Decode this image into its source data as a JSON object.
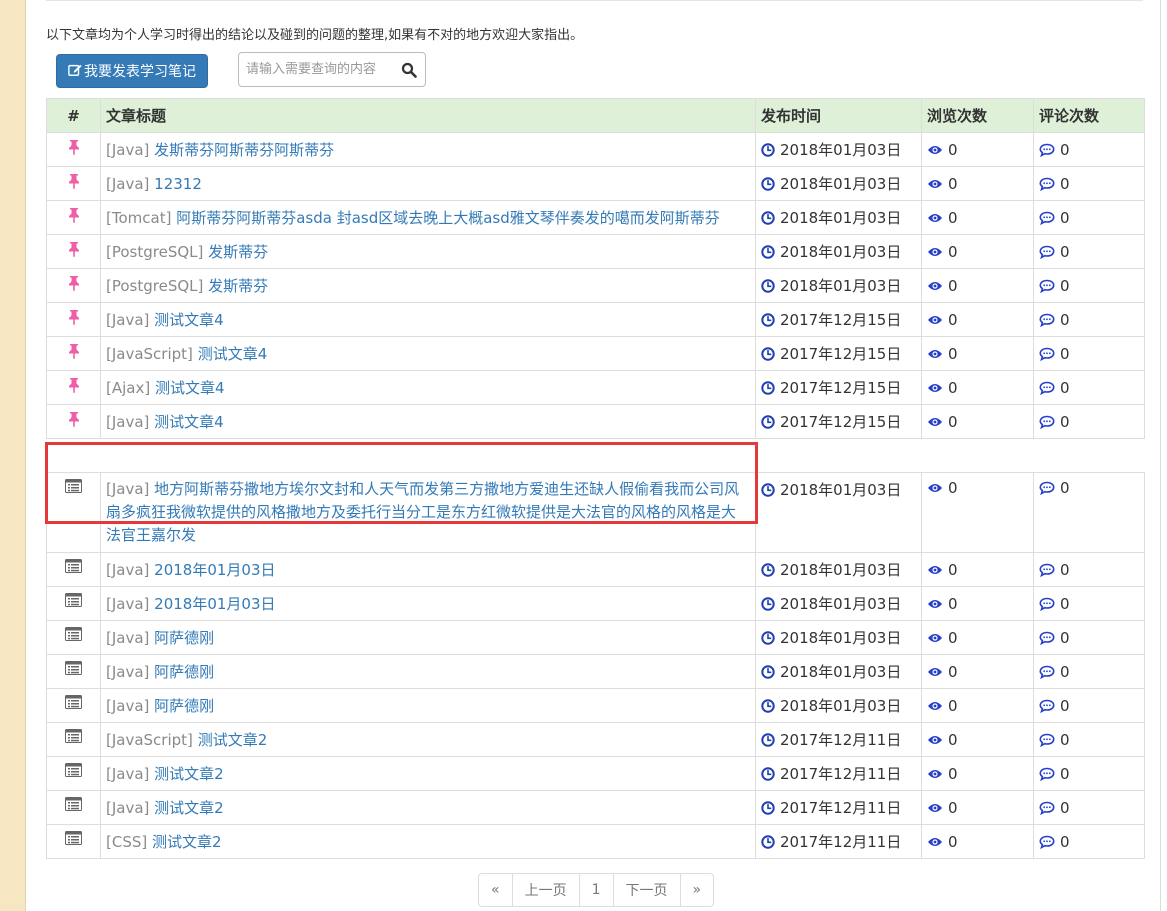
{
  "notice": "以下文章均为个人学习时得出的结论以及碰到的问题的整理,如果有不对的地方欢迎大家指出。",
  "toolbar": {
    "post_label": "我要发表学习笔记"
  },
  "search": {
    "placeholder": "请输入需要查询的内容"
  },
  "table": {
    "headers": [
      "#",
      "文章标题",
      "发布时间",
      "浏览次数",
      "评论次数"
    ],
    "pinned_rows": [
      {
        "category": "[Java]",
        "title": "发斯蒂芬阿斯蒂芬阿斯蒂芬",
        "date": "2018年01月03日",
        "views": "0",
        "comments": "0"
      },
      {
        "category": "[Java]",
        "title": "12312",
        "date": "2018年01月03日",
        "views": "0",
        "comments": "0"
      },
      {
        "category": "[Tomcat]",
        "title": "阿斯蒂芬阿斯蒂芬asda 封asd区域去晚上大概asd雅文琴伴奏发的噶而发阿斯蒂芬",
        "date": "2018年01月03日",
        "views": "0",
        "comments": "0"
      },
      {
        "category": "[PostgreSQL]",
        "title": "发斯蒂芬",
        "date": "2018年01月03日",
        "views": "0",
        "comments": "0"
      },
      {
        "category": "[PostgreSQL]",
        "title": "发斯蒂芬",
        "date": "2018年01月03日",
        "views": "0",
        "comments": "0"
      },
      {
        "category": "[Java]",
        "title": "测试文章4",
        "date": "2017年12月15日",
        "views": "0",
        "comments": "0"
      },
      {
        "category": "[JavaScript]",
        "title": "测试文章4",
        "date": "2017年12月15日",
        "views": "0",
        "comments": "0"
      },
      {
        "category": "[Ajax]",
        "title": "测试文章4",
        "date": "2017年12月15日",
        "views": "0",
        "comments": "0"
      },
      {
        "category": "[Java]",
        "title": "测试文章4",
        "date": "2017年12月15日",
        "views": "0",
        "comments": "0"
      }
    ],
    "normal_rows": [
      {
        "category": "[Java]",
        "title": "地方阿斯蒂芬撒地方埃尔文封和人天气而发第三方撒地方爱迪生还缺人假偷看我而公司风扇多疯狂我微软提供的风格撒地方及委托行当分工是东方红微软提供是大法官的风格的风格是大法官王嘉尔发",
        "date": "2018年01月03日",
        "views": "0",
        "comments": "0",
        "tall": true
      },
      {
        "category": "[Java]",
        "title": "2018年01月03日",
        "date": "2018年01月03日",
        "views": "0",
        "comments": "0"
      },
      {
        "category": "[Java]",
        "title": "2018年01月03日",
        "date": "2018年01月03日",
        "views": "0",
        "comments": "0"
      },
      {
        "category": "[Java]",
        "title": "阿萨德刚",
        "date": "2018年01月03日",
        "views": "0",
        "comments": "0"
      },
      {
        "category": "[Java]",
        "title": "阿萨德刚",
        "date": "2018年01月03日",
        "views": "0",
        "comments": "0"
      },
      {
        "category": "[Java]",
        "title": "阿萨德刚",
        "date": "2018年01月03日",
        "views": "0",
        "comments": "0"
      },
      {
        "category": "[JavaScript]",
        "title": "测试文章2",
        "date": "2017年12月11日",
        "views": "0",
        "comments": "0"
      },
      {
        "category": "[Java]",
        "title": "测试文章2",
        "date": "2017年12月11日",
        "views": "0",
        "comments": "0"
      },
      {
        "category": "[Java]",
        "title": "测试文章2",
        "date": "2017年12月11日",
        "views": "0",
        "comments": "0"
      },
      {
        "category": "[CSS]",
        "title": "测试文章2",
        "date": "2017年12月11日",
        "views": "0",
        "comments": "0"
      }
    ]
  },
  "pagination": {
    "first": "«",
    "prev": "上一页",
    "page": "1",
    "next": "下一页",
    "last": "»"
  },
  "colors": {
    "accent": "#337ab7",
    "header_bg": "#dff0d8",
    "pin": "#ee5fa7",
    "highlight": "#e5383b"
  },
  "icons": {
    "pinned": "pushpin-icon",
    "normal": "list-alt-icon",
    "date": "clock-icon",
    "views": "eye-icon",
    "comments": "comment-icon",
    "edit": "edit-icon",
    "search": "search-icon"
  }
}
